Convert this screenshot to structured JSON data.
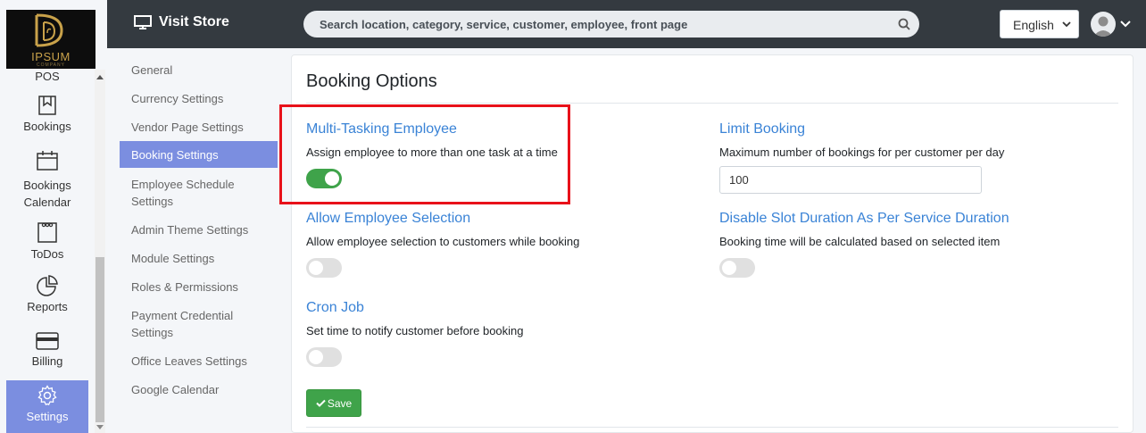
{
  "logo": {
    "text": "IPSUM",
    "subtext": "COMPANY"
  },
  "sidebar": {
    "items": [
      {
        "label": "POS",
        "icon": "pos-icon"
      },
      {
        "label": "Bookings",
        "icon": "bookings-icon"
      },
      {
        "label": "Bookings Calendar",
        "icon": "calendar-icon"
      },
      {
        "label": "ToDos",
        "icon": "todos-icon"
      },
      {
        "label": "Reports",
        "icon": "pie-chart-icon"
      },
      {
        "label": "Billing",
        "icon": "credit-card-icon"
      },
      {
        "label": "Settings",
        "icon": "gear-icon",
        "active": true
      }
    ]
  },
  "topbar": {
    "visit_store_label": "Visit Store",
    "search_placeholder": "Search location, category, service, customer, employee, front page",
    "language": "English"
  },
  "submenu": {
    "items": [
      {
        "label": "General"
      },
      {
        "label": "Currency Settings"
      },
      {
        "label": "Vendor Page Settings"
      },
      {
        "label": "Booking Settings",
        "active": true
      },
      {
        "label": "Employee Schedule Settings"
      },
      {
        "label": "Admin Theme Settings"
      },
      {
        "label": "Module Settings"
      },
      {
        "label": "Roles & Permissions"
      },
      {
        "label": "Payment Credential Settings"
      },
      {
        "label": "Office Leaves Settings"
      },
      {
        "label": "Google Calendar"
      }
    ]
  },
  "card": {
    "title": "Booking Options",
    "options": {
      "multi_tasking": {
        "title": "Multi-Tasking Employee",
        "desc": "Assign employee to more than one task at a time",
        "enabled": true
      },
      "limit_booking": {
        "title": "Limit Booking",
        "desc": "Maximum number of bookings for per customer per day",
        "value": "100"
      },
      "employee_selection": {
        "title": "Allow Employee Selection",
        "desc": "Allow employee selection to customers while booking",
        "enabled": false
      },
      "disable_slot": {
        "title": "Disable Slot Duration As Per Service Duration",
        "desc": "Booking time will be calculated based on selected item",
        "enabled": false
      },
      "cron_job": {
        "title": "Cron Job",
        "desc": "Set time to notify customer before booking",
        "enabled": false
      }
    },
    "save_label": "Save"
  },
  "colors": {
    "topbar": "#343a40",
    "accent": "#7b8ee0",
    "link": "#3a83d6",
    "success": "#3fa34a",
    "highlight": "#e8111a"
  }
}
